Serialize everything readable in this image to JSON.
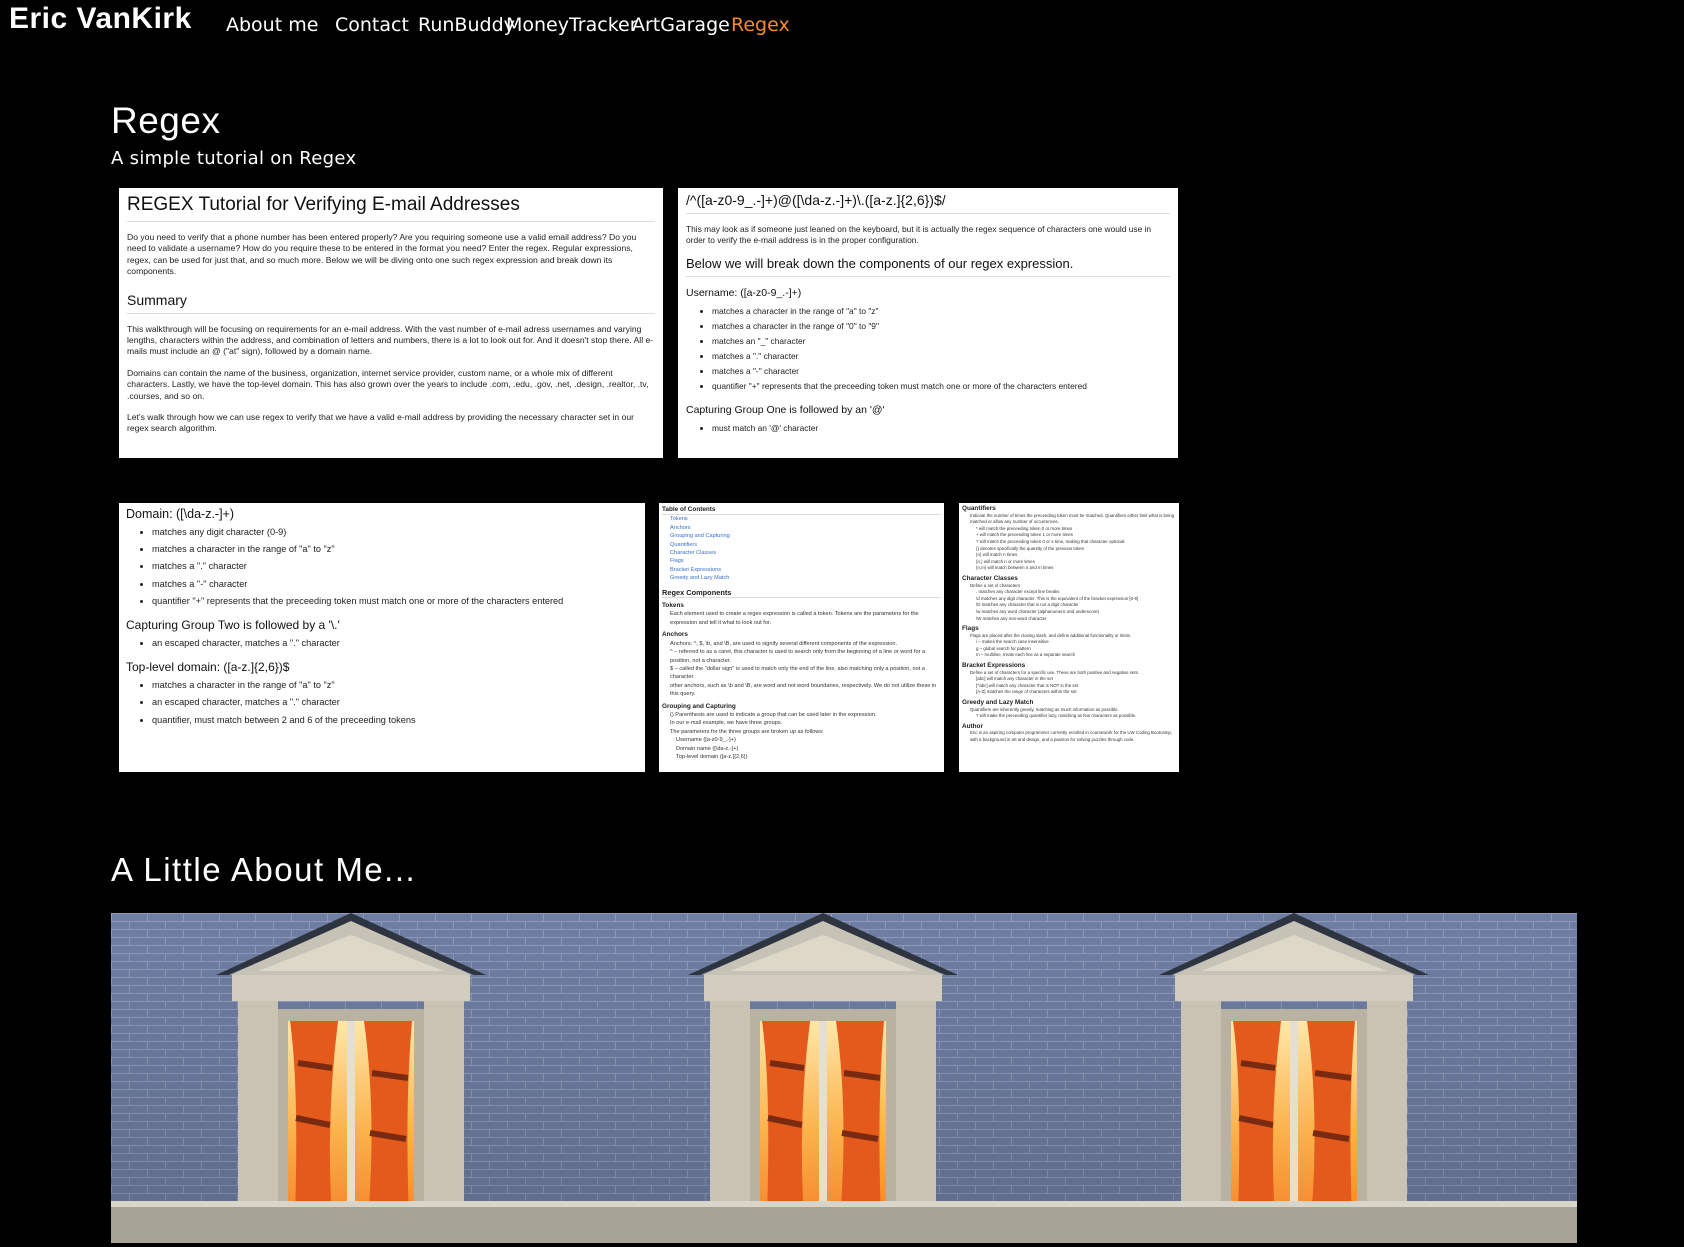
{
  "brand": "Eric VanKirk",
  "nav": [
    "About me",
    "Contact",
    "RunBuddy",
    "MoneyTracker",
    "ArtGarage",
    "Regex"
  ],
  "hero": {
    "title": "Regex",
    "subtitle": "A simple tutorial on Regex"
  },
  "card1": {
    "title": "REGEX Tutorial for Verifying E-mail Addresses",
    "intro": "Do you need to verify that a phone number has been entered properly? Are you requiring someone use a valid email address? Do you need to validate a username? How do you require these to be entered in the format you need? Enter the regex. Regular expressions, regex, can be used for just that, and so much more. Below we will be diving onto one such regex expression and break down its components.",
    "summary_heading": "Summary",
    "p1": "This walkthrough will be focusing on requirements for an e-mail address. With the vast number of e-mail adress usernames and varying lengths, characters within the address, and combination of letters and numbers, there is a lot to look out for. And it doesn't stop there. All e-mails must include an @ (\"at\" sign), followed by a domain name.",
    "p2": "Domains can contain the name of the business, organization, internet service provider, custom name, or a whole mix of different characters. Lastly, we have the top-level domain. This has also grown over the years to include .com, .edu, .gov, .net, .design, .realtor, .tv, .courses, and so on.",
    "p3": "Let's walk through how we can use regex to verify that we have a valid e-mail address by providing the necessary character set in our regex search algorithm."
  },
  "card2": {
    "title": "/^([a-z0-9_.-]+)@([\\da-z.-]+)\\.([a-z.]{2,6})$/",
    "intro": "This may look as if someone just leaned on the keyboard, but it is actually the regex sequence of characters one would use in order to verify the e-mail address is in the proper configuration.",
    "heading": "Below we will break down the components of our regex expression.",
    "username_heading": "Username: ([a-z0-9_.-]+)",
    "username_items": [
      "matches a character in the range of \"a\" to \"z\"",
      "matches a character in the range of \"0\" to \"9\"",
      "matches an \"_\" character",
      "matches a \".\" character",
      "matches a \"-\" character",
      "quantifier \"+\" represents that the preceeding token must match one or more of the characters entered"
    ],
    "group_heading": "Capturing Group One is followed by an '@'",
    "group_items": [
      "must match an '@' character"
    ]
  },
  "card3": {
    "domain_heading": "Domain: ([\\da-z.-]+)",
    "domain_items": [
      "matches any digit character (0-9)",
      "matches a character in the range of \"a\" to \"z\"",
      "matches a \".\" character",
      "matches a \"-\" character",
      "quantifier \"+\" represents that the preceeding token must match one or more of the characters entered"
    ],
    "group_heading": "Capturing Group Two is followed by a '\\.'",
    "group_items": [
      "an escaped character, matches a \".\" character"
    ],
    "tld_heading": "Top-level domain: ([a-z.]{2,6})$",
    "tld_items": [
      "matches a character in the range of \"a\" to \"z\"",
      "an escaped character, matches a \".\" character",
      "quantifier, must match between 2 and 6 of the preceeding tokens"
    ]
  },
  "card4": {
    "toc_heading": "Table of Contents",
    "toc_items": [
      "Tokens",
      "Anchors",
      "Grouping and Capturing",
      "Quantifiers",
      "Character Classes",
      "Flags",
      "Bracket Expressions",
      "Greedy and Lazy Match"
    ],
    "components_heading": "Regex Components",
    "tokens_heading": "Tokens",
    "tokens_text": "Each element used to create a regex expression is called a token. Tokens are the parameters for the expression and tell it what to look out for.",
    "anchors_heading": "Anchors",
    "anchors_items": [
      "Anchors: ^, $, \\b, and \\B, are used to signify several different components of the expression.",
      "^ – referred to as a caret, this character is used to search only from the beginning of a line or word for a position, not a character.",
      "$ – called the \"dollar sign\" is used to match only the end of the line, also matching only a position, not a character.",
      "other anchors, such as \\b and \\B, are word and not word boundaries, respectively. We do not utilize these in this query."
    ],
    "grouping_heading": "Grouping and Capturing",
    "grouping_items": [
      "() Parenthesis are used to indicate a group that can be used later in the expression.",
      "In our e-mail example, we have three groups.",
      "The parameters for the three groups are broken up as follows:"
    ],
    "grouping_sub": [
      "Username ([a-z0-9_.-]+)",
      "Domain name ([\\da-z.-]+)",
      "Top-level domain ([a-z.]{2,6})"
    ]
  },
  "card5": {
    "quant_heading": "Quantifiers",
    "quant_items": [
      "Indicate the number of times the preceeding token must be matched. Quantifiers either limit what is being matched or allow any number of occurrences.",
      "* will match the preceeding token 0 or more times",
      "+ will match the preceeding token 1 or more times",
      "? will match the preceeding token 0 or 1 time, making that character optional",
      "{} denotes specifically the quantity of the previous token",
      "{n} will match n times",
      "{n,} will match n or more times",
      "{n,m} will match between n and m times"
    ],
    "class_heading": "Character Classes",
    "class_items": [
      "Define a set of characters",
      ". matches any character except line breaks",
      "\\d matches any digit character. This is the equivalent of the bracket expression [0-9]",
      "\\D matches any character that is not a digit character",
      "\\w matches any word character (alphanumeric and underscore)",
      "\\W matches any non-word character"
    ],
    "flags_heading": "Flags",
    "flags_items": [
      "Flags are placed after the closing slash, and define additional functionality or limits.",
      "i – makes the search case insensitive",
      "g – global search for pattern",
      "m – multiline, treats each line as a separate search"
    ],
    "bracket_heading": "Bracket Expressions",
    "bracket_items": [
      "Define a set of characters for a specific use. These are both positive and negative sets.",
      "[abc] will match any character in the set",
      "[^abc] will match any character that is NOT in the set",
      "[A-Z] matches the range of characters within the set"
    ],
    "greedy_heading": "Greedy and Lazy Match",
    "greedy_items": [
      "Quantifiers are inherently greedy, matching as much information as possible.",
      "? will make the preceeding quantifier lazy, matching as few characters as possible."
    ],
    "author_heading": "Author",
    "author_text": "Eric is an aspiring computer programmer currently enrolled in coursework for the UW Coding Bootcamp, with a background in art and design, and a passion for solving puzzles through code."
  },
  "about": {
    "title": "A Little About Me..."
  },
  "colors": {
    "accent": "#f08c2e",
    "background": "#000000"
  },
  "icons": {
    "photo": "house-dormer-windows-image"
  }
}
